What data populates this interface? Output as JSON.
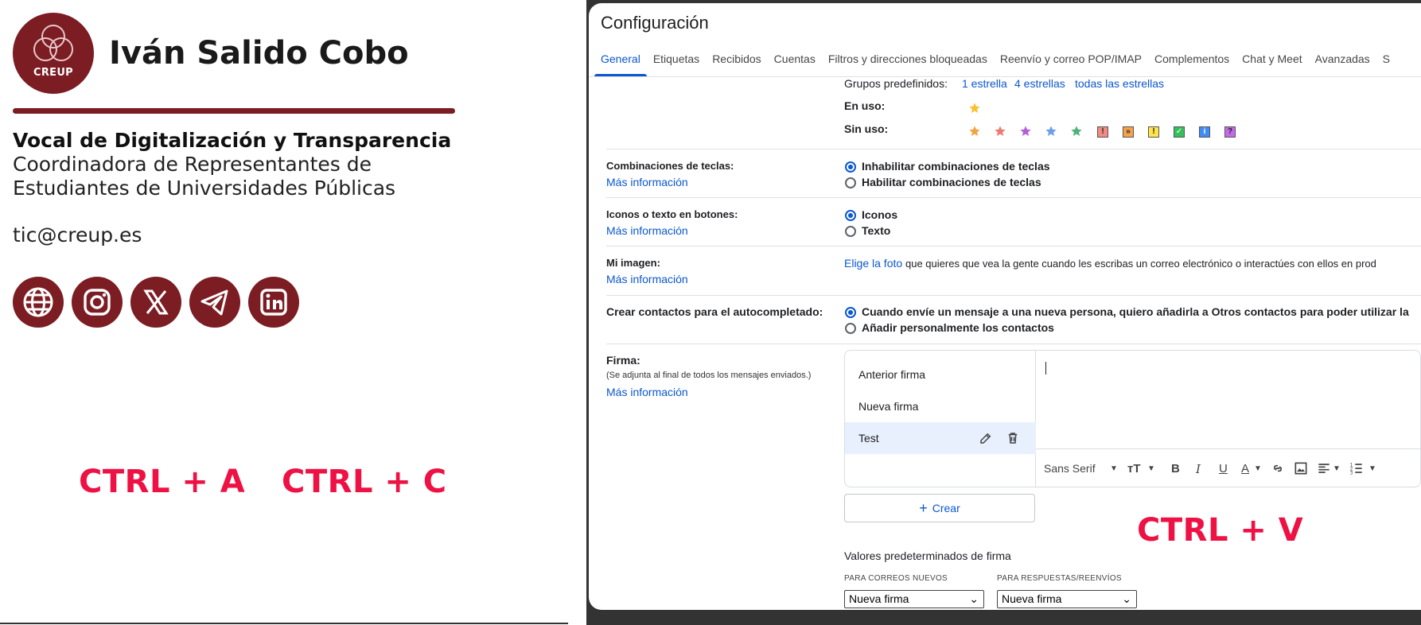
{
  "signature": {
    "logo_text": "CREUP",
    "name": "Iván Salido Cobo",
    "role": "Vocal de Digitalización y Transparencia",
    "org_line1": "Coordinadora de Representantes de",
    "org_line2": "Estudiantes de Universidades Públicas",
    "email": "tic@creup.es",
    "social_icons": [
      "globe-icon",
      "instagram-icon",
      "x-icon",
      "telegram-icon",
      "linkedin-icon"
    ],
    "brand_color": "#7b1d23"
  },
  "shortcuts": {
    "select_all": "CTRL + A",
    "copy": "CTRL + C",
    "paste": "CTRL + V",
    "color": "#ee1144"
  },
  "gmail": {
    "title": "Configuración",
    "tabs": [
      "General",
      "Etiquetas",
      "Recibidos",
      "Cuentas",
      "Filtros y direcciones bloqueadas",
      "Reenvío y correo POP/IMAP",
      "Complementos",
      "Chat y Meet",
      "Avanzadas",
      "S"
    ],
    "active_tab": "General",
    "stars": {
      "presets_label": "Grupos predefinidos:",
      "presets": [
        "1 estrella",
        "4 estrellas",
        "todas las estrellas"
      ],
      "in_use_label": "En uso:",
      "unused_label": "Sin uso:"
    },
    "shortcuts_setting": {
      "label": "Combinaciones de teclas:",
      "more": "Más información",
      "options": [
        "Inhabilitar combinaciones de teclas",
        "Habilitar combinaciones de teclas"
      ],
      "selected": 0
    },
    "buttons_setting": {
      "label": "Iconos o texto en botones:",
      "more": "Más información",
      "options": [
        "Iconos",
        "Texto"
      ],
      "selected": 0
    },
    "picture_setting": {
      "label": "Mi imagen:",
      "more": "Más información",
      "link": "Elige la foto",
      "text": "que quieres que vea la gente cuando les escribas un correo electrónico o interactúes con ellos en prod"
    },
    "contacts_setting": {
      "label": "Crear contactos para el autocompletado:",
      "options": [
        "Cuando envíe un mensaje a una nueva persona, quiero añadirla a Otros contactos para poder utilizar la",
        "Añadir personalmente los contactos"
      ],
      "selected": 0
    },
    "signature_setting": {
      "label": "Firma:",
      "sublabel": "(Se adjunta al final de todos los mensajes enviados.)",
      "more": "Más información",
      "items": [
        "Anterior firma",
        "Nueva firma",
        "Test"
      ],
      "selected": "Test",
      "font": "Sans Serif",
      "create": "Crear",
      "defaults_title": "Valores predeterminados de firma",
      "new_mail_caption": "PARA CORREOS NUEVOS",
      "reply_caption": "PARA RESPUESTAS/REENVÍOS",
      "new_mail_value": "Nueva firma",
      "reply_value": "Nueva firma"
    }
  }
}
